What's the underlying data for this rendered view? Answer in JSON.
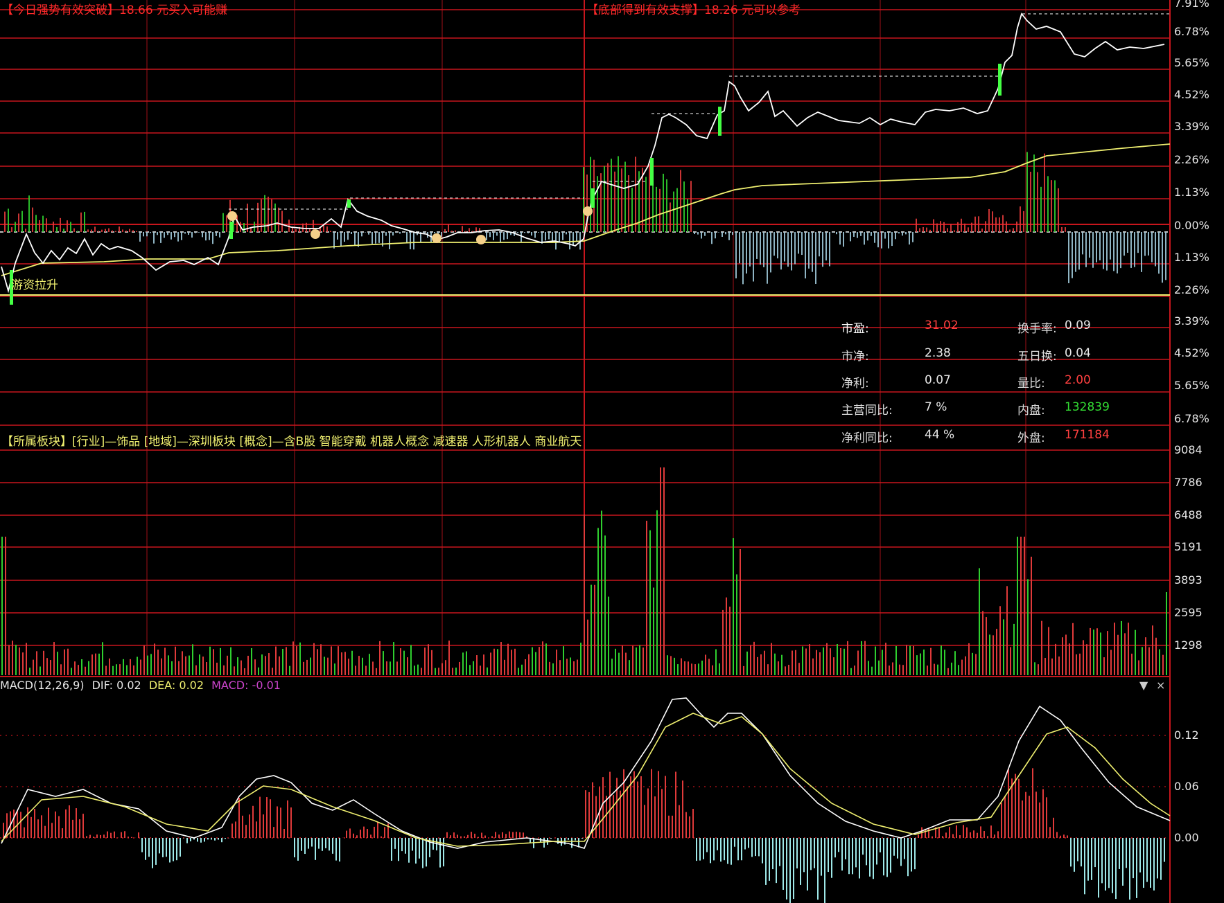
{
  "signals": {
    "left": "【今日强势有效突破】18.66 元买入可能赚",
    "right": "【底部得到有效支撑】18.26 元可以参考"
  },
  "price_axis": [
    "7.91%",
    "6.78%",
    "5.65%",
    "4.52%",
    "3.39%",
    "2.26%",
    "1.13%",
    "0.00%",
    "1.13%",
    "2.26%",
    "3.39%",
    "4.52%",
    "5.65%",
    "6.78%"
  ],
  "volume_axis": [
    "9084",
    "7786",
    "6488",
    "5191",
    "3893",
    "2595",
    "1298"
  ],
  "macd_axis": [
    "0.12",
    "0.06",
    "0.00"
  ],
  "annotation_tag": "游资拉升",
  "sector_line": "【所属板块】[行业]—饰品 [地域]—深圳板块 [概念]—含B股 智能穿戴 机器人概念 减速器 人形机器人 商业航天",
  "fundamentals": {
    "pe_label": "市盈:",
    "pe_value": "31.02",
    "pb_label": "市净:",
    "pb_value": "2.38",
    "profit_label": "净利:",
    "profit_value": "0.07",
    "rev_yoy_label": "主营同比:",
    "rev_yoy_value": "7 %",
    "profit_yoy_label": "净利同比:",
    "profit_yoy_value": "44 %",
    "turnover_label": "换手率:",
    "turnover_value": "0.09",
    "turnover5_label": "五日换:",
    "turnover5_value": "0.04",
    "vol_ratio_label": "量比:",
    "vol_ratio_value": "2.00",
    "inner_label": "内盘:",
    "inner_value": "132839",
    "outer_label": "外盘:",
    "outer_value": "171184"
  },
  "macd": {
    "name": "MACD(12,26,9)",
    "dif": "DIF: 0.02",
    "dea": "DEA: 0.02",
    "macd": "MACD: -0.01"
  },
  "controls": {
    "dropdown": "▼",
    "close": "×"
  },
  "colors": {
    "grid_red": "#c8161d",
    "price_line": "#ffffff",
    "avg_line": "#f0f070",
    "up": "#ff4a4a",
    "down": "#33dd33",
    "macd_neg": "#9ee8e8",
    "dea_line": "#f0f070",
    "magenta": "#cc44cc"
  }
}
